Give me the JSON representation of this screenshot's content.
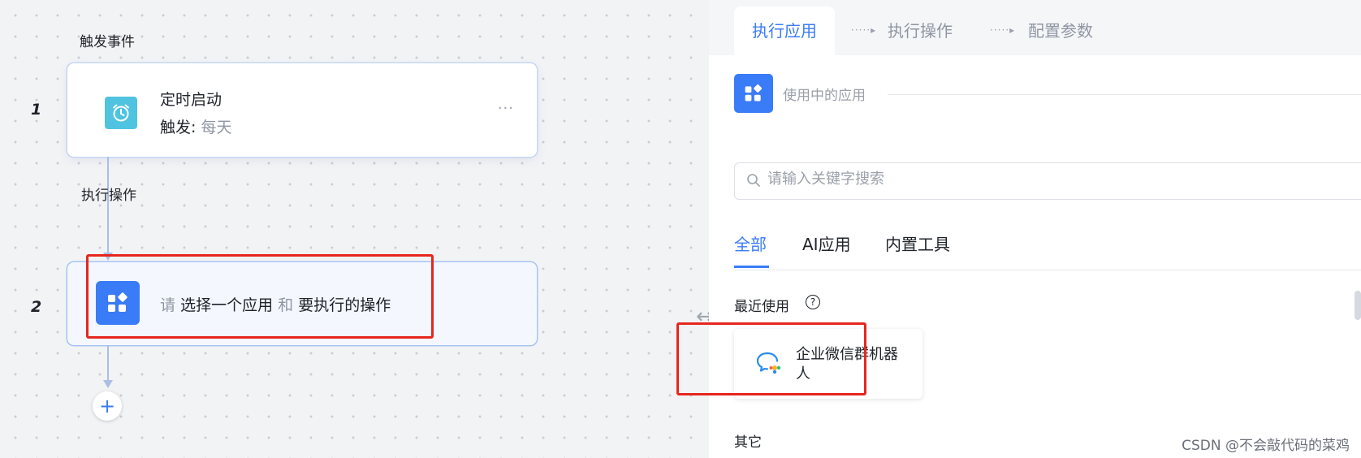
{
  "canvas": {
    "trigger_section_label": "触发事件",
    "action_section_label": "执行操作",
    "steps": [
      {
        "number": "1",
        "title": "定时启动",
        "sub_prefix": "触发:",
        "sub_value": "每天",
        "more": "···"
      },
      {
        "number": "2",
        "placeholder_please": "请",
        "placeholder_select_app": "选择一个应用",
        "placeholder_and": "和",
        "placeholder_action": "要执行的操作"
      }
    ],
    "add_button": "+",
    "highlight_color": "#e6261f"
  },
  "panel": {
    "steps": [
      {
        "label": "执行应用",
        "active": true
      },
      {
        "label": "执行操作",
        "active": false
      },
      {
        "label": "配置参数",
        "active": false
      }
    ],
    "step_separator": "·····▸",
    "using_apps_label": "使用中的应用",
    "search": {
      "placeholder": "请输入关键字搜索",
      "value": ""
    },
    "tabs": [
      {
        "label": "全部",
        "active": true
      },
      {
        "label": "AI应用",
        "active": false
      },
      {
        "label": "内置工具",
        "active": false
      }
    ],
    "recent_label": "最近使用",
    "help_icon": "?",
    "recent_apps": [
      {
        "name": "企业微信群机器人",
        "icon": "wecom-chat-icon"
      }
    ],
    "other_label": "其它",
    "accent_color": "#3a7bf7"
  },
  "watermark": "CSDN @不会敲代码的菜鸡"
}
